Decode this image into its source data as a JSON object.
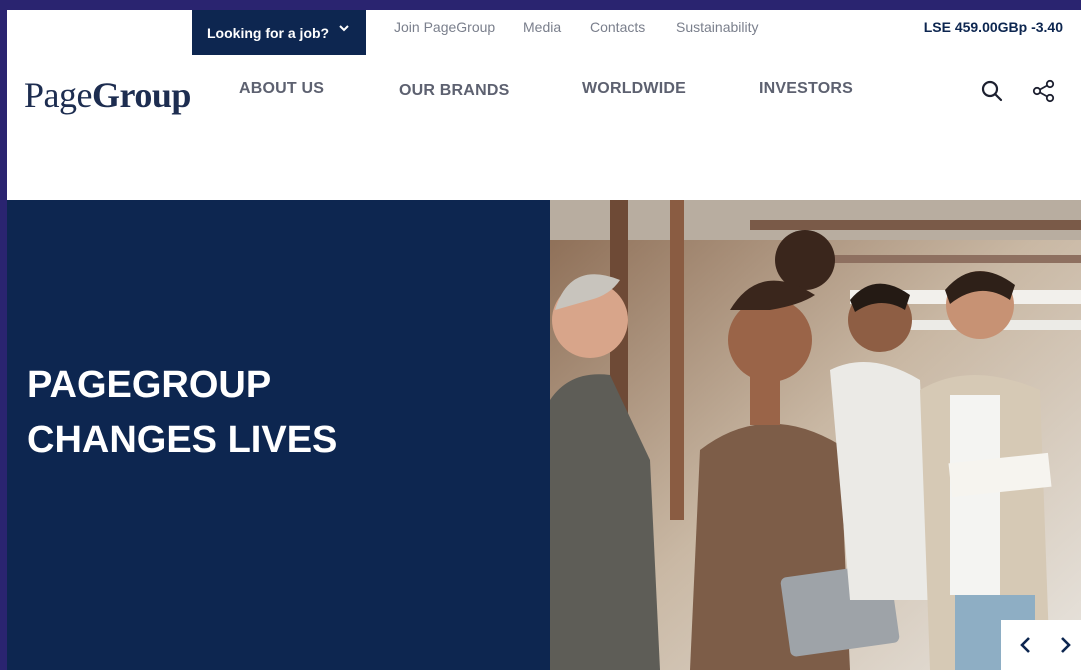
{
  "utility": {
    "job_button": "Looking for a job?",
    "links": [
      "Join PageGroup",
      "Media",
      "Contacts",
      "Sustainability"
    ],
    "stock": "LSE 459.00GBp -3.40"
  },
  "logo": {
    "part1": "Page",
    "part2": "Group"
  },
  "nav": [
    "ABOUT US",
    "OUR BRANDS",
    "WORLDWIDE",
    "INVESTORS"
  ],
  "icons": {
    "search": "search-icon",
    "share": "share-icon",
    "prev": "chevron-left-icon",
    "next": "chevron-right-icon"
  },
  "hero": {
    "title": "PAGEGROUP CHANGES LIVES"
  },
  "colors": {
    "navy": "#0d2650",
    "frame": "#2a2470",
    "nav_text": "#5d6170",
    "util_text": "#7a7f8c"
  }
}
